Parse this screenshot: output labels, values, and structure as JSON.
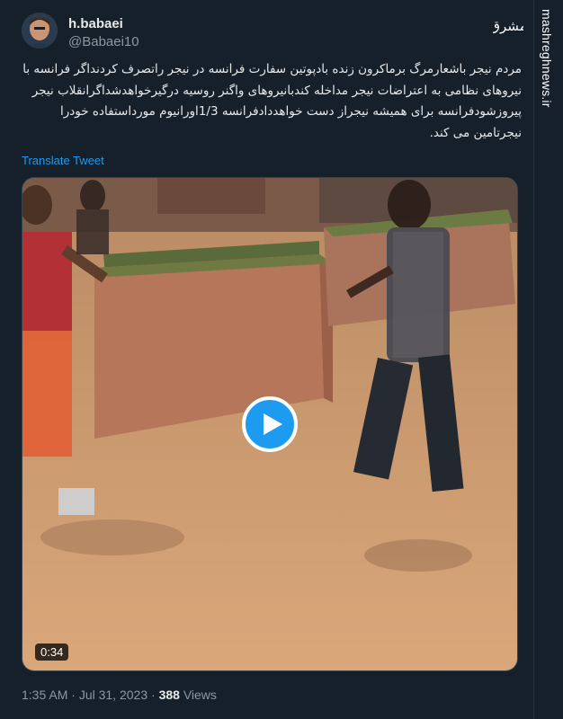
{
  "author": {
    "display_name": "h.babaei",
    "handle": "@Babaei10"
  },
  "tweet": {
    "lines": [
      "مردم نیجر باشعارمرگ برماکرون زنده بادپوتین سفارت فرانسه در نیجر راتصرف کردنداگر فرانسه با",
      "نیروهای نظامی به اعتراضات نیجر مداخله کندبانیروهای واگنر روسیه درگیرخواهدشداگرانقلاب نیجر",
      "پیروزشودفرانسه برای همیشه نیجراز دست خواهددادفرانسه 1/3اورانیوم مورداستفاده خودرا",
      "نیجرتامین  می کند."
    ],
    "translate_label": "Translate Tweet"
  },
  "media": {
    "duration": "0:34",
    "play_icon": "play-icon"
  },
  "meta": {
    "time": "1:35 AM",
    "separator1": " · ",
    "date": "Jul 31, 2023",
    "separator2": " · ",
    "views_count": "388",
    "views_label": " Views"
  },
  "watermark": {
    "site": "mashreghnews.ir",
    "logo": "مشرق"
  },
  "colors": {
    "background": "#15202b",
    "text": "#e7e9ea",
    "secondary": "#8b98a5",
    "accent": "#1d9bf0"
  }
}
